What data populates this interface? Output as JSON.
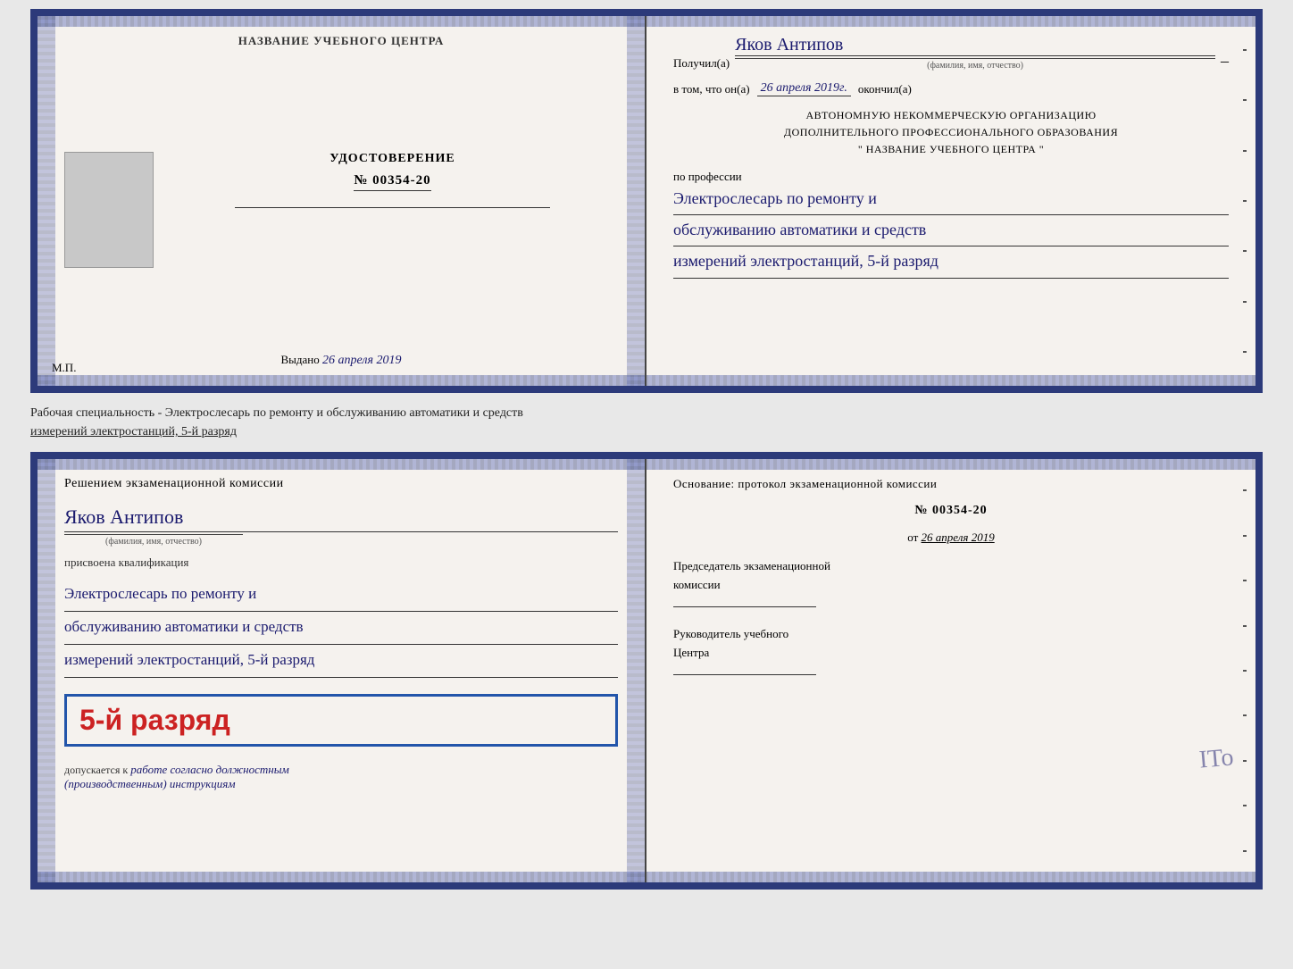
{
  "top_left": {
    "training_center": "НАЗВАНИЕ УЧЕБНОГО ЦЕНТРА",
    "cert_title": "УДОСТОВЕРЕНИЕ",
    "cert_number": "№ 00354-20",
    "issued_label": "Выдано",
    "issued_date": "26 апреля 2019",
    "mp": "М.П."
  },
  "top_right": {
    "received_label": "Получил(а)",
    "recipient_name": "Яков Антипов",
    "fio_label": "(фамилия, имя, отчество)",
    "in_that_label": "в том, что он(а)",
    "date_value": "26 апреля 2019г.",
    "finished_label": "окончил(а)",
    "org_line1": "АВТОНОМНУЮ НЕКОММЕРЧЕСКУЮ ОРГАНИЗАЦИЮ",
    "org_line2": "ДОПОЛНИТЕЛЬНОГО ПРОФЕССИОНАЛЬНОГО ОБРАЗОВАНИЯ",
    "org_line3": "\" НАЗВАНИЕ УЧЕБНОГО ЦЕНТРА \"",
    "profession_label": "по профессии",
    "profession_line1": "Электрослесарь по ремонту и",
    "profession_line2": "обслуживанию автоматики и средств",
    "profession_line3": "измерений электростанций, 5-й разряд"
  },
  "middle_text": {
    "line1": "Рабочая специальность - Электрослесарь по ремонту и обслуживанию автоматики и средств",
    "line2_underlined": "измерений электростанций, 5-й разряд"
  },
  "bottom_left": {
    "decision_text": "Решением экзаменационной комиссии",
    "person_name": "Яков Антипов",
    "fio_label": "(фамилия, имя, отчество)",
    "qualification_label": "присвоена квалификация",
    "qual_line1": "Электрослесарь по ремонту и",
    "qual_line2": "обслуживанию автоматики и средств",
    "qual_line3": "измерений электростанций, 5-й разряд",
    "grade_text": "5-й разряд",
    "allowed_label": "допускается к",
    "allowed_text": "работе согласно должностным",
    "instructions_text": "(производственным) инструкциям"
  },
  "bottom_right": {
    "basis_label": "Основание: протокол экзаменационной комиссии",
    "protocol_number": "№ 00354-20",
    "date_label": "от",
    "date_value": "26 апреля 2019",
    "chairman_title": "Председатель экзаменационной",
    "chairman_title2": "комиссии",
    "director_title": "Руководитель учебного",
    "director_title2": "Центра"
  },
  "ito_watermark": "ITo"
}
